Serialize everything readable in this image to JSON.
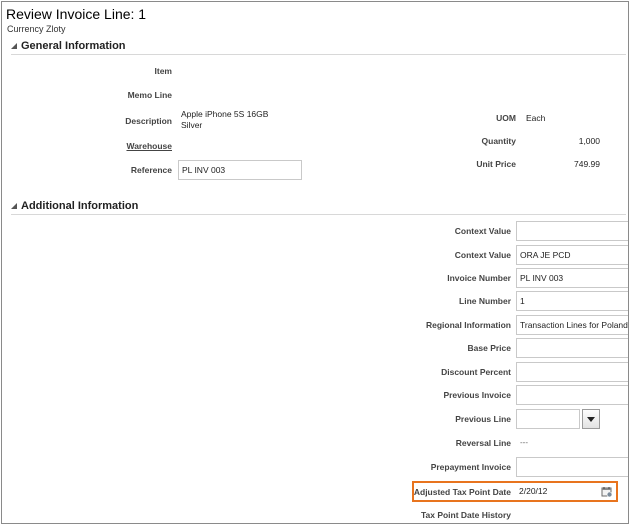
{
  "page": {
    "title": "Review Invoice Line: 1",
    "currency": "Currency Zloty"
  },
  "general": {
    "heading": "General Information",
    "item_label": "Item",
    "memo_label": "Memo Line",
    "description_label": "Description",
    "description_line1": "Apple iPhone 5S 16GB",
    "description_line2": "Silver",
    "warehouse_label": "Warehouse",
    "reference_label": "Reference",
    "reference_value": "PL INV 003",
    "uom_label": "UOM",
    "uom_value": "Each",
    "quantity_label": "Quantity",
    "quantity_value": "1,000",
    "unit_price_label": "Unit Price",
    "unit_price_value": "749.99"
  },
  "additional": {
    "heading": "Additional Information",
    "context_value_label": "Context Value",
    "context_value_1": "",
    "context_value_2": "ORA JE PCD",
    "invoice_number_label": "Invoice Number",
    "invoice_number_value": "PL INV 003",
    "line_number_label": "Line Number",
    "line_number_value": "1",
    "regional_info_label": "Regional Information",
    "regional_info_value": "Transaction Lines for Poland",
    "base_price_label": "Base Price",
    "base_price_value": "",
    "discount_percent_label": "Discount Percent",
    "discount_percent_value": "",
    "previous_invoice_label": "Previous Invoice",
    "previous_invoice_value": "",
    "previous_line_label": "Previous Line",
    "previous_line_value": "",
    "reversal_line_label": "Reversal Line",
    "reversal_line_value": "---",
    "prepayment_invoice_label": "Prepayment Invoice",
    "prepayment_invoice_value": "",
    "adjusted_tax_label": "Adjusted Tax Point Date",
    "adjusted_tax_value": "2/20/12",
    "tax_history_label": "Tax Point Date History"
  },
  "colors": {
    "highlight": "#e8741e"
  },
  "icons": {
    "collapse": "triangle-expanded-icon",
    "calendar": "calendar-icon",
    "dropdown": "chevron-down-icon"
  }
}
